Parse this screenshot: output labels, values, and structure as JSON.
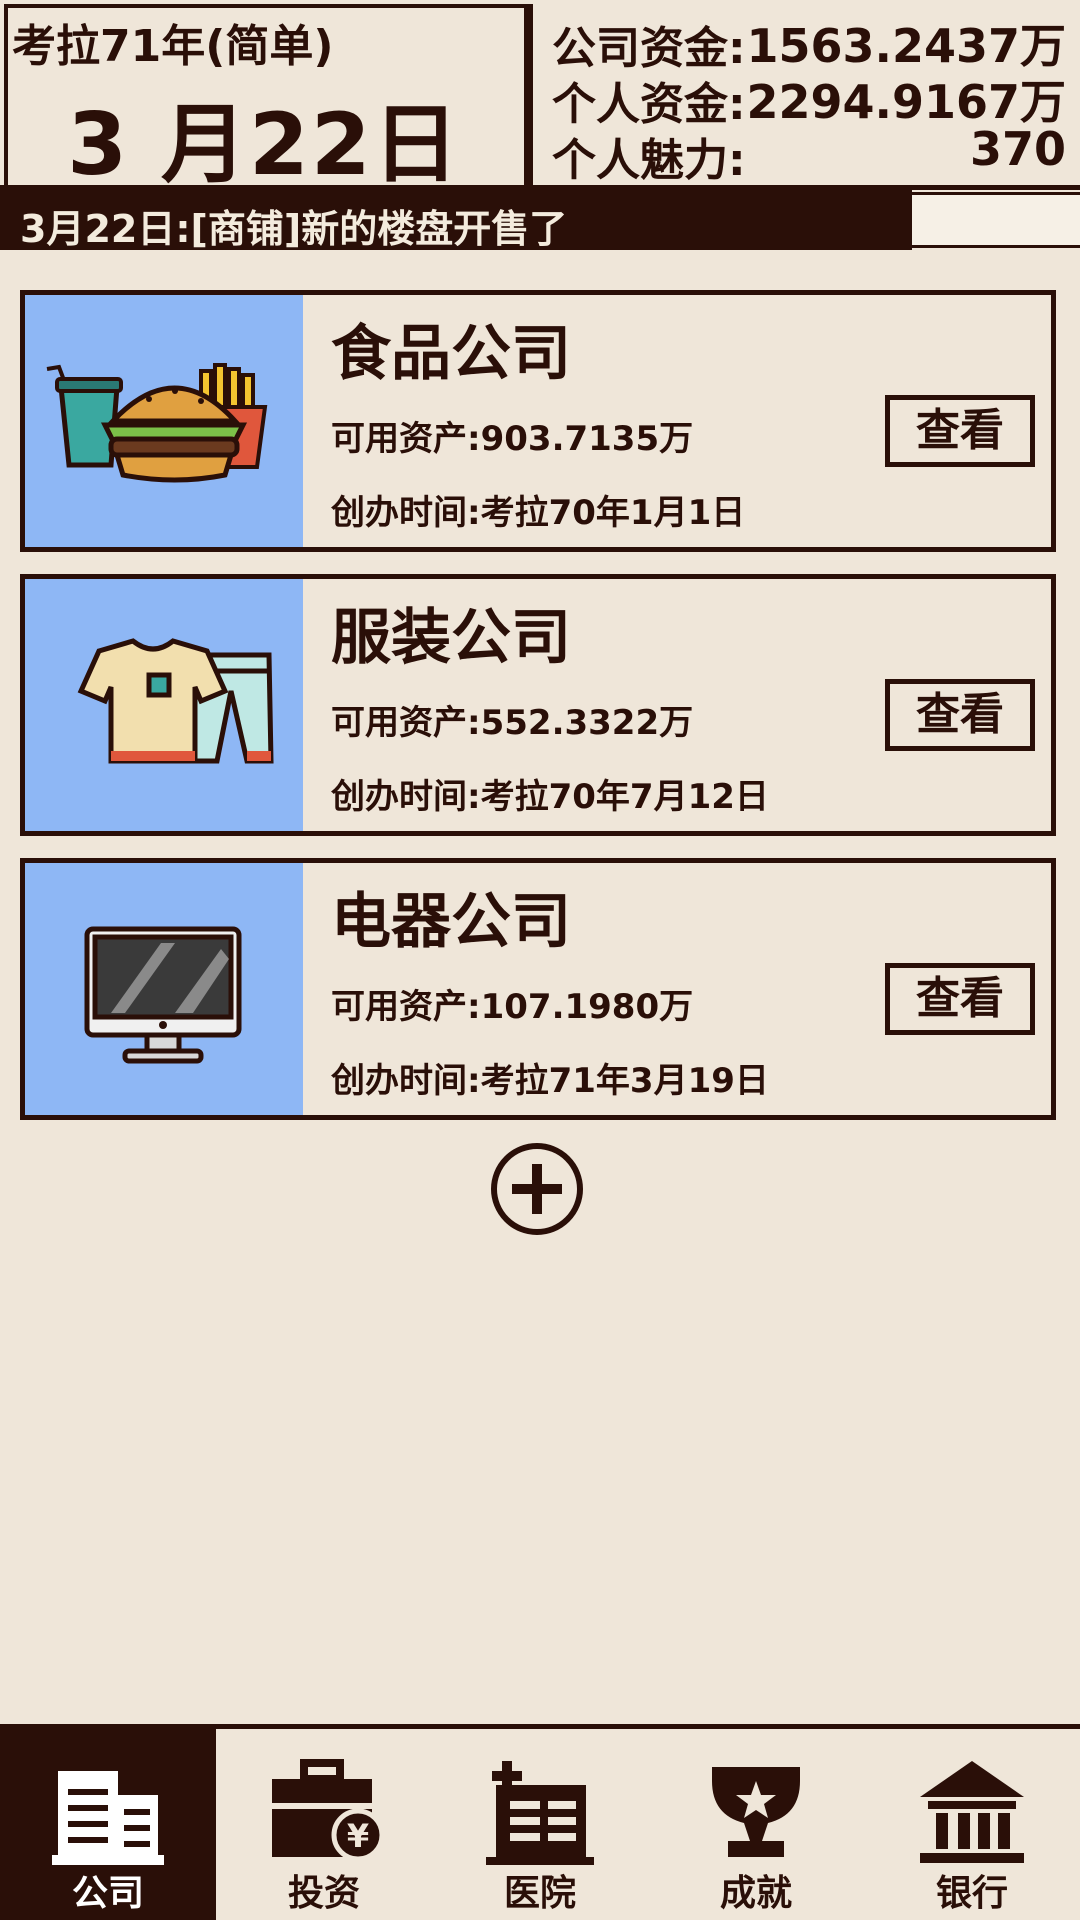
{
  "header": {
    "year": "考拉71年(简单)",
    "date": "3 月22日",
    "company_funds_label": "公司资金:",
    "company_funds_value": "1563.2437万",
    "personal_funds_label": "个人资金:",
    "personal_funds_value": "2294.9167万",
    "charisma_label": "个人魅力:",
    "charisma_value": "370"
  },
  "news": "3月22日:[商铺]新的楼盘开售了",
  "companies": [
    {
      "name": "食品公司",
      "assets": "可用资产:903.7135万",
      "founded": "创办时间:考拉70年1月1日",
      "view": "查看",
      "icon": "food-icon"
    },
    {
      "name": "服装公司",
      "assets": "可用资产:552.3322万",
      "founded": "创办时间:考拉70年7月12日",
      "view": "查看",
      "icon": "clothing-icon"
    },
    {
      "name": "电器公司",
      "assets": "可用资产:107.1980万",
      "founded": "创办时间:考拉71年3月19日",
      "view": "查看",
      "icon": "monitor-icon"
    }
  ],
  "nav": [
    {
      "label": "公司",
      "icon": "office-building-icon",
      "active": true
    },
    {
      "label": "投资",
      "icon": "briefcase-yen-icon",
      "active": false
    },
    {
      "label": "医院",
      "icon": "hospital-icon",
      "active": false
    },
    {
      "label": "成就",
      "icon": "trophy-icon",
      "active": false
    },
    {
      "label": "银行",
      "icon": "bank-icon",
      "active": false
    }
  ],
  "colors": {
    "dark": "#2a0f08",
    "paper": "#efe6d9",
    "image_bg": "#8eb7f5"
  }
}
